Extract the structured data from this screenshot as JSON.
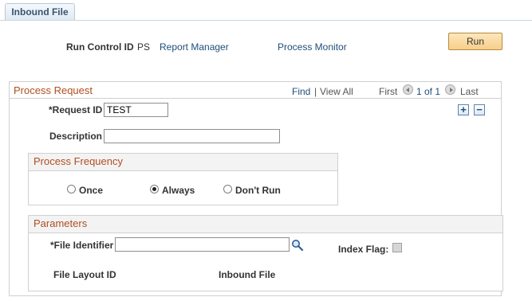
{
  "page_tab": {
    "label": "Inbound File"
  },
  "header": {
    "run_control_label": "Run Control ID",
    "run_control_value": "PS",
    "report_manager_link": "Report Manager",
    "process_monitor_link": "Process Monitor",
    "run_button": "Run"
  },
  "process_request": {
    "title": "Process Request",
    "nav": {
      "find": "Find",
      "separator": "|",
      "view_all": "View All",
      "first": "First",
      "range": "1 of 1",
      "last": "Last"
    },
    "add_row_symbol": "+",
    "delete_row_symbol": "−",
    "request_id_label": "*Request ID",
    "request_id_value": "TEST",
    "description_label": "Description",
    "description_value": "",
    "frequency": {
      "title": "Process Frequency",
      "options": [
        {
          "label": "Once",
          "selected": false
        },
        {
          "label": "Always",
          "selected": true
        },
        {
          "label": "Don't Run",
          "selected": false
        }
      ]
    },
    "parameters": {
      "title": "Parameters",
      "file_identifier_label": "*File Identifier",
      "file_identifier_value": "",
      "index_flag_label": "Index Flag:",
      "index_flag_checked": false,
      "file_layout_id_label": "File Layout ID",
      "inbound_file_label": "Inbound File"
    }
  },
  "colors": {
    "group_title": "#b04e21",
    "link": "#1f4e79",
    "run_button_bg": "#f6cf89"
  },
  "icons": {
    "lookup": "magnifier-icon",
    "prev": "previous-arrow-icon",
    "next": "next-arrow-icon"
  }
}
